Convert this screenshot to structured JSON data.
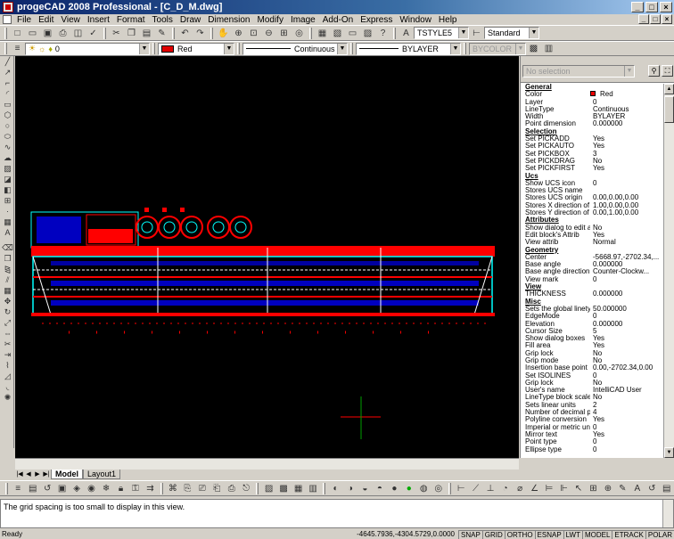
{
  "window": {
    "title": "progeCAD 2008 Professional - [C_D_M.dwg]"
  },
  "menu": [
    "File",
    "Edit",
    "View",
    "Insert",
    "Format",
    "Tools",
    "Draw",
    "Dimension",
    "Modify",
    "Image",
    "Add-On",
    "Express",
    "Window",
    "Help"
  ],
  "toolbar1": {
    "textstyle": "TSTYLE5",
    "dimstyle": "Standard"
  },
  "toolbar2": {
    "layer": "0",
    "color": "Red",
    "linetype": "Continuous",
    "lineweight": "BYLAYER",
    "plotstyle": "BYCOLOR"
  },
  "tabs": [
    "Model",
    "Layout1"
  ],
  "properties": {
    "selection": "No selection",
    "rows": [
      {
        "cat": true,
        "k": "General"
      },
      {
        "k": "Color",
        "v": "Red"
      },
      {
        "k": "Layer",
        "v": "0"
      },
      {
        "k": "LineType",
        "v": "Continuous"
      },
      {
        "k": "Width",
        "v": "BYLAYER"
      },
      {
        "k": "Point dimension",
        "v": "0.000000"
      },
      {
        "cat": true,
        "k": "Selection"
      },
      {
        "k": "Set PICKADD",
        "v": "Yes"
      },
      {
        "k": "Set PICKAUTO",
        "v": "Yes"
      },
      {
        "k": "Set PICKBOX",
        "v": "3"
      },
      {
        "k": "Set PICKDRAG",
        "v": "No"
      },
      {
        "k": "Set PICKFIRST",
        "v": "Yes"
      },
      {
        "cat": true,
        "k": "Ucs"
      },
      {
        "k": "Show UCS icon",
        "v": "0"
      },
      {
        "k": "Stores UCS name",
        "v": ""
      },
      {
        "k": "Stores UCS origin",
        "v": "0.00,0.00,0.00"
      },
      {
        "k": "Stores X direction of UCS",
        "v": "1.00,0.00,0.00"
      },
      {
        "k": "Stores Y direction of UCS",
        "v": "0.00,1.00,0.00"
      },
      {
        "cat": true,
        "k": "Attributes"
      },
      {
        "k": "Show dialog to edit attrib",
        "v": "No"
      },
      {
        "k": "Edit block's Attrib",
        "v": "Yes"
      },
      {
        "k": "View attrib",
        "v": "Normal"
      },
      {
        "cat": true,
        "k": "Geometry"
      },
      {
        "k": "Center",
        "v": "-5668.97,-2702.34,..."
      },
      {
        "k": "Base angle",
        "v": "0.000000"
      },
      {
        "k": "Base angle direction",
        "v": "Counter-Clockw..."
      },
      {
        "k": "View mark",
        "v": "0"
      },
      {
        "cat": true,
        "k": "View"
      },
      {
        "k": "THICKNESS",
        "v": "0.000000"
      },
      {
        "cat": true,
        "k": "Misc"
      },
      {
        "k": "Sets the global linetype ...",
        "v": "50.000000"
      },
      {
        "k": "EdgeMode",
        "v": "0"
      },
      {
        "k": "Elevation",
        "v": "0.000000"
      },
      {
        "k": "Cursor Size",
        "v": "5"
      },
      {
        "k": "Show dialog boxes",
        "v": "Yes"
      },
      {
        "k": "Fill area",
        "v": "Yes"
      },
      {
        "k": "Grip lock",
        "v": "No"
      },
      {
        "k": "Grip mode",
        "v": "No"
      },
      {
        "k": "Insertion base point",
        "v": "0.00,-2702.34,0.00"
      },
      {
        "k": "Set ISOLINES",
        "v": "0"
      },
      {
        "k": "Grip lock",
        "v": "No"
      },
      {
        "k": "User's name",
        "v": "IntelliCAD User"
      },
      {
        "k": "LineType block scale",
        "v": "No"
      },
      {
        "k": "Sets linear units",
        "v": "2"
      },
      {
        "k": "Number of decimal places",
        "v": "4"
      },
      {
        "k": "Polyline conversion",
        "v": "Yes"
      },
      {
        "k": "Imperial or metric units",
        "v": "0"
      },
      {
        "k": "Mirror text",
        "v": "Yes"
      },
      {
        "k": "Point type",
        "v": "0"
      },
      {
        "k": "Ellipse type",
        "v": "0"
      }
    ]
  },
  "command": {
    "message": "The grid spacing is too small to display in this view."
  },
  "status": {
    "ready": "Ready",
    "coords": "-4645.7936,-4304.5729,0.0000",
    "modes": [
      "SNAP",
      "GRID",
      "ORTHO",
      "ESNAP",
      "LWT",
      "MODEL",
      "ETRACK",
      "POLAR"
    ]
  }
}
